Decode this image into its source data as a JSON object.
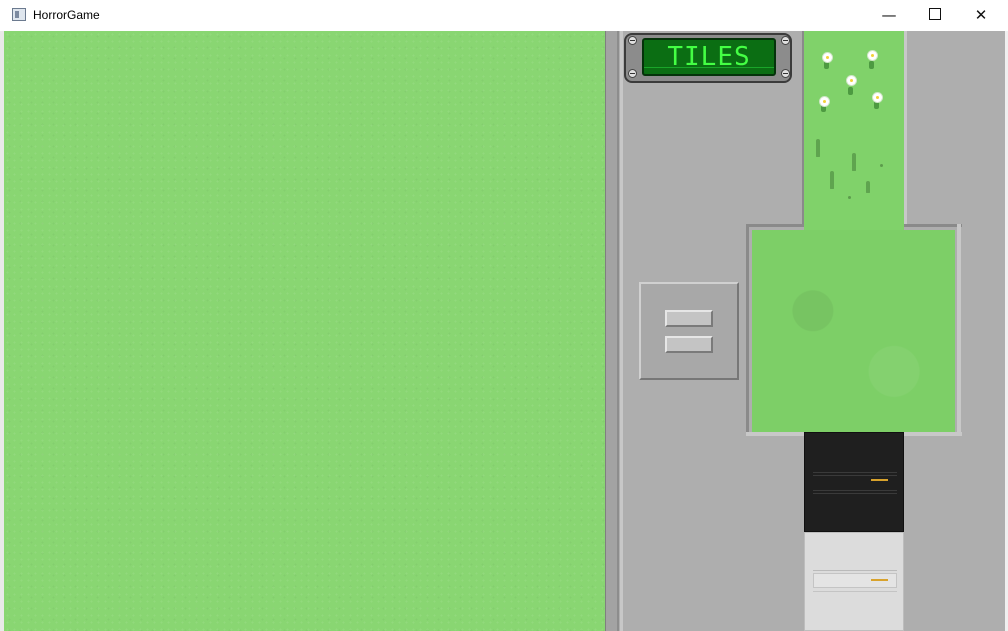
{
  "window": {
    "title": "HorrorGame",
    "minimize_glyph": "—",
    "close_glyph": "✕"
  },
  "game": {
    "viewport_color": "#89d672"
  },
  "panel": {
    "header_label": "TILES",
    "lcd_text_color": "#44ff44",
    "panel_color": "#aeaeae",
    "menu_icon": "hamburger-menu-icon"
  },
  "tiles": [
    {
      "name": "grass-flowers",
      "color": "#80d26a"
    },
    {
      "name": "grass-tufts",
      "color": "#80d26a"
    },
    {
      "name": "grass-plain",
      "color": "#7dcf67"
    },
    {
      "name": "dark-cabinet",
      "color": "#1f1f1f"
    },
    {
      "name": "light-cabinet",
      "color": "#dcdcdc"
    }
  ]
}
